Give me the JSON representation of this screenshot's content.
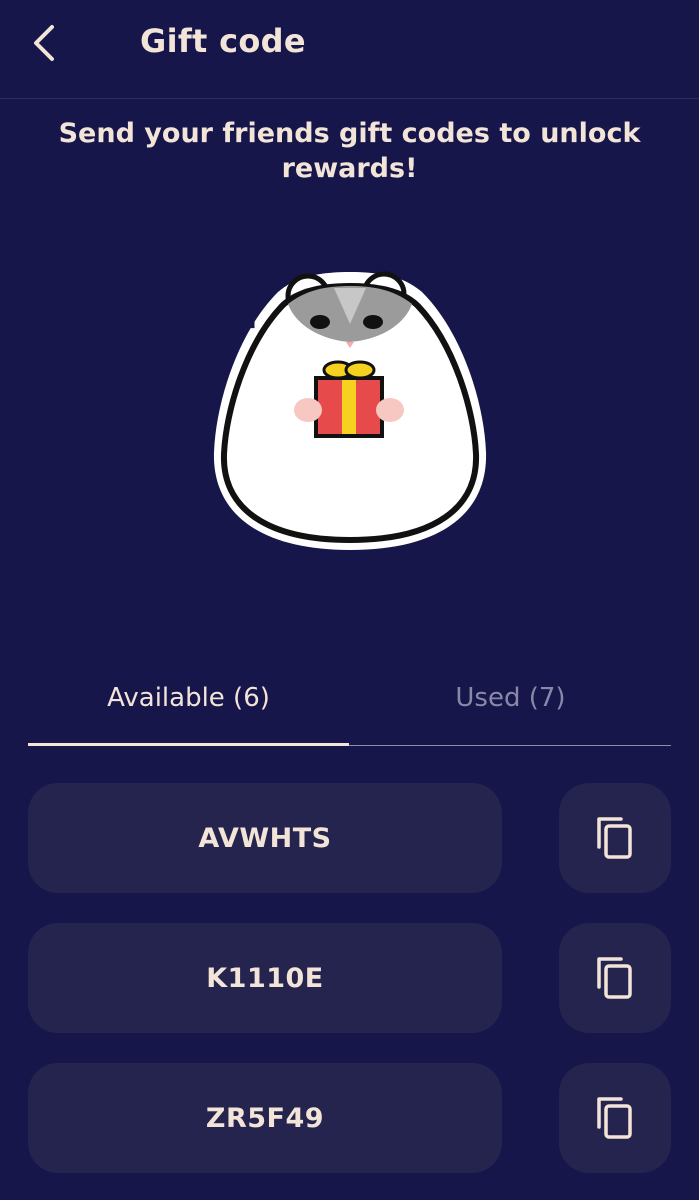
{
  "header": {
    "title": "Gift code",
    "back_icon": "chevron-left-icon"
  },
  "subtitle": "Send your friends gift codes to unlock rewards!",
  "illustration": "hamster-holding-gift-icon",
  "tabs": [
    {
      "label": "Available (6)",
      "active": true
    },
    {
      "label": "Used (7)",
      "active": false
    }
  ],
  "codes": [
    {
      "code": "AVWHTS",
      "copy_icon": "copy-icon"
    },
    {
      "code": "K1110E",
      "copy_icon": "copy-icon"
    },
    {
      "code": "ZR5F49",
      "copy_icon": "copy-icon"
    }
  ],
  "colors": {
    "background": "#16164a",
    "card": "#24244e",
    "text": "#f3e4d8",
    "inactive_tab": "#8a88a8"
  }
}
